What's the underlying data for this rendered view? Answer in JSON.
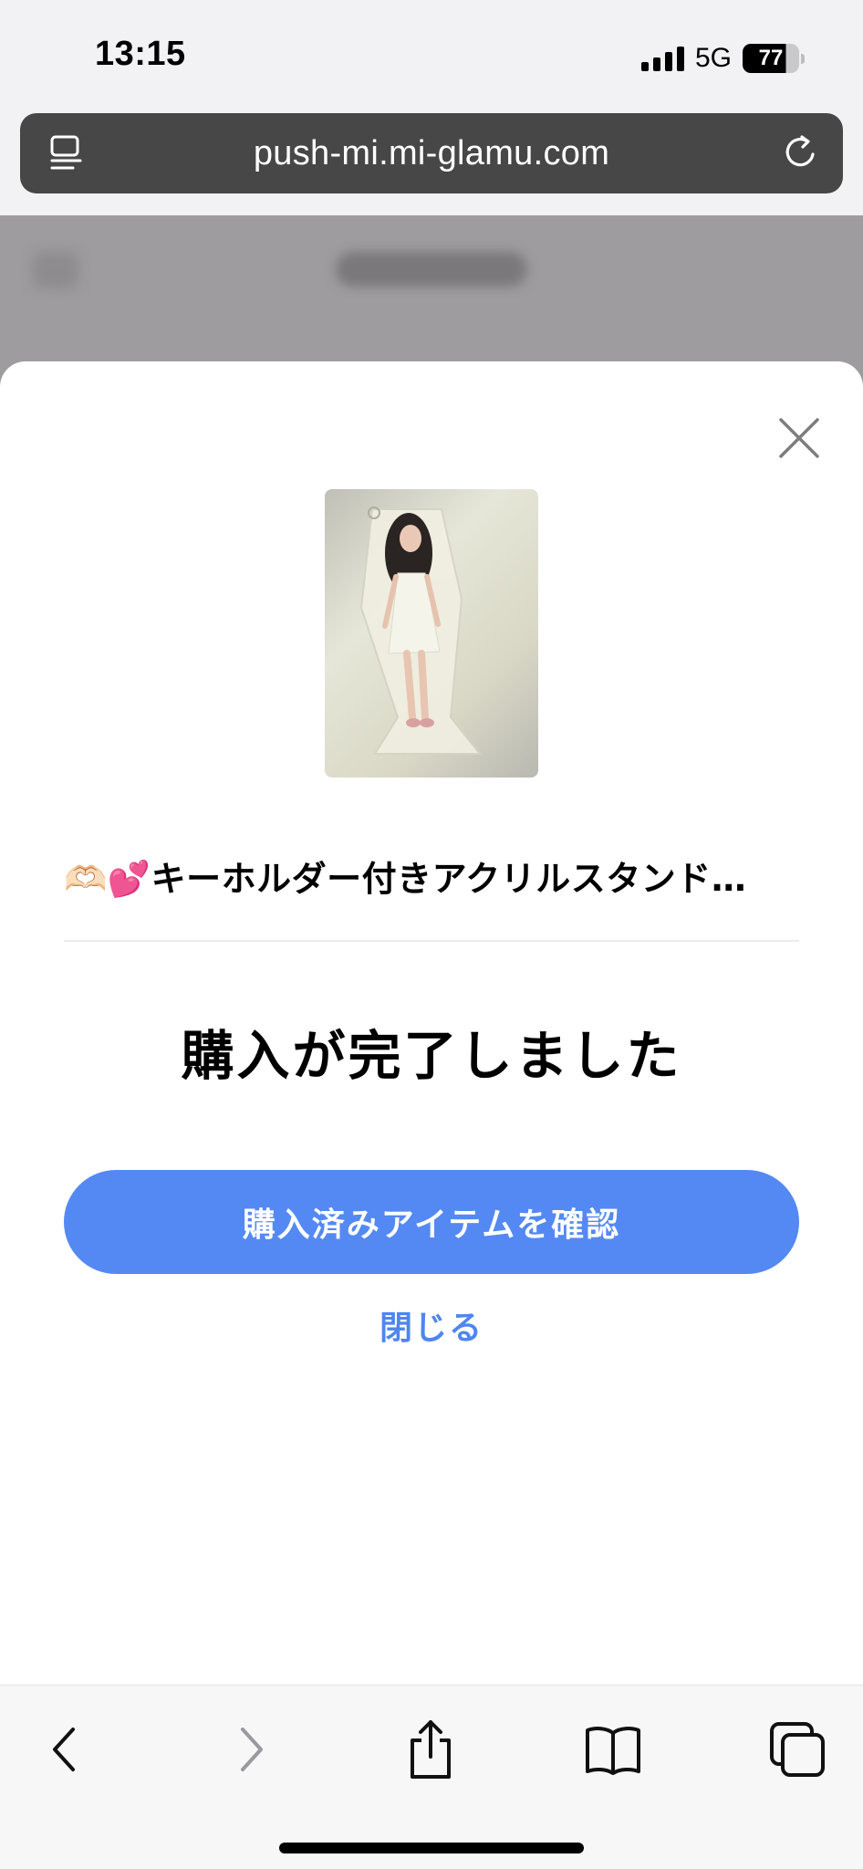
{
  "status_bar": {
    "time": "13:15",
    "network": "5G",
    "battery": "77"
  },
  "browser": {
    "url": "push-mi.mi-glamu.com"
  },
  "modal": {
    "product_title": "🫶🏻💕キーホルダー付きアクリルスタンド…",
    "heading": "購入が完了しました",
    "confirm_button_label": "購入済みアイテムを確認",
    "close_link_label": "閉じる",
    "accent_color": "#5489f3"
  },
  "toolbar": {
    "icons": [
      "back-icon",
      "forward-icon",
      "share-icon",
      "bookmarks-icon",
      "tabs-icon"
    ]
  }
}
